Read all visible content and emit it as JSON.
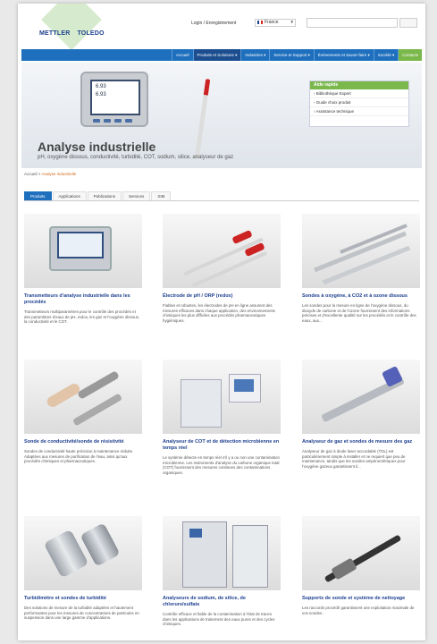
{
  "header": {
    "logo_left": "METTLER",
    "logo_right": "TOLEDO",
    "login": "Login / Enregistrement",
    "language": "France"
  },
  "nav": [
    {
      "label": "Accueil"
    },
    {
      "label": "Produits et Solutions"
    },
    {
      "label": "Industries"
    },
    {
      "label": "Service et Support"
    },
    {
      "label": "Événements et Savoir-faire"
    },
    {
      "label": "Société"
    },
    {
      "label": "Contacts"
    }
  ],
  "hero": {
    "title": "Analyse industrielle",
    "subtitle": "pH, oxygène dissous, conductivité, turbidité, COT, sodium, silice, analyseur de gaz",
    "screen_value_1": "6.93",
    "screen_value_2": "6.93"
  },
  "quick_access": {
    "title": "Aide rapide",
    "links": [
      "Bibliothèque Expert",
      "Guide choix produit",
      "Assistance technique"
    ]
  },
  "breadcrumb": {
    "home": "Accueil",
    "separator": ">",
    "current": "Analyse industrielle"
  },
  "tabs": [
    "Produits",
    "Applications",
    "Publications",
    "Services",
    "SIM"
  ],
  "products": [
    {
      "title": "Transmetteurs d'analyse industrielle dans les procédés",
      "desc": "Transmetteurs multiparamètres pour le contrôle des procédés et des paramètres d'eaux de pH, redox, les gaz et l'oxygène dissous, la conductivité et le COT."
    },
    {
      "title": "Électrode de pH / ORP (redox)",
      "desc": "Fiables et robustes, les électrodes de pH en ligne assurent des mesures efficaces dans chaque application, des environnements chimiques les plus difficiles aux procédés pharmaceutiques hygiéniques."
    },
    {
      "title": "Sondes à oxygène, à CO2 et à ozone dissous",
      "desc": "Les sondes pour la mesure en ligne de l'oxygène dissous, du dioxyde de carbone et de l'ozone fournissent des informations précises et d'excellente qualité sur les procédés et le contrôle des eaux, aux..."
    },
    {
      "title": "Sonde de conductivité/sonde de résistivité",
      "desc": "Sondes de conductivité haute précision à maintenance réduite. Adaptées aux mesures de purification de l'eau, ainsi qu'aux procédés chimiques et pharmaceutiques."
    },
    {
      "title": "Analyseur de COT et de détection microbienne en temps réel",
      "desc": "Le système détecte en temps réel s'il y a ou non une contamination microbienne. Les instruments d'analyse du carbone organique total (COT) fournissent des mesures continues des contaminations organiques."
    },
    {
      "title": "Analyseur de gaz et sondes de mesure des gaz",
      "desc": "Analyseur de gaz à diode laser accordable (TDL) est particulièrement simple à installer et ne requiert que peu de maintenance, tandis que les sondes ampérométriques pour l'oxygène gazeux garantissent il..."
    },
    {
      "title": "Turbidimètre et sondes de turbidité",
      "desc": "Des solutions de mesure de la turbidité adaptées et hautement performantes pour les mesures de concentrations de particules en suspension dans une large gamme d'applications."
    },
    {
      "title": "Analyseurs de sodium, de silice, de chlorure/sulfate",
      "desc": "Contrôle efficace et fiable de la contamination à l'état de traces dans les applications de traitement des eaux pures et des cycles chimiques."
    },
    {
      "title": "Supports de sonde et système de nettoyage",
      "desc": "Les raccords procédé garantissent une exploitation maximale de vos sondes."
    }
  ],
  "colors": {
    "nav_blue": "#1e6fbd",
    "accent_green": "#7ab84b",
    "title_blue": "#1d3f8f",
    "breadcrumb_orange": "#d36a1c"
  }
}
